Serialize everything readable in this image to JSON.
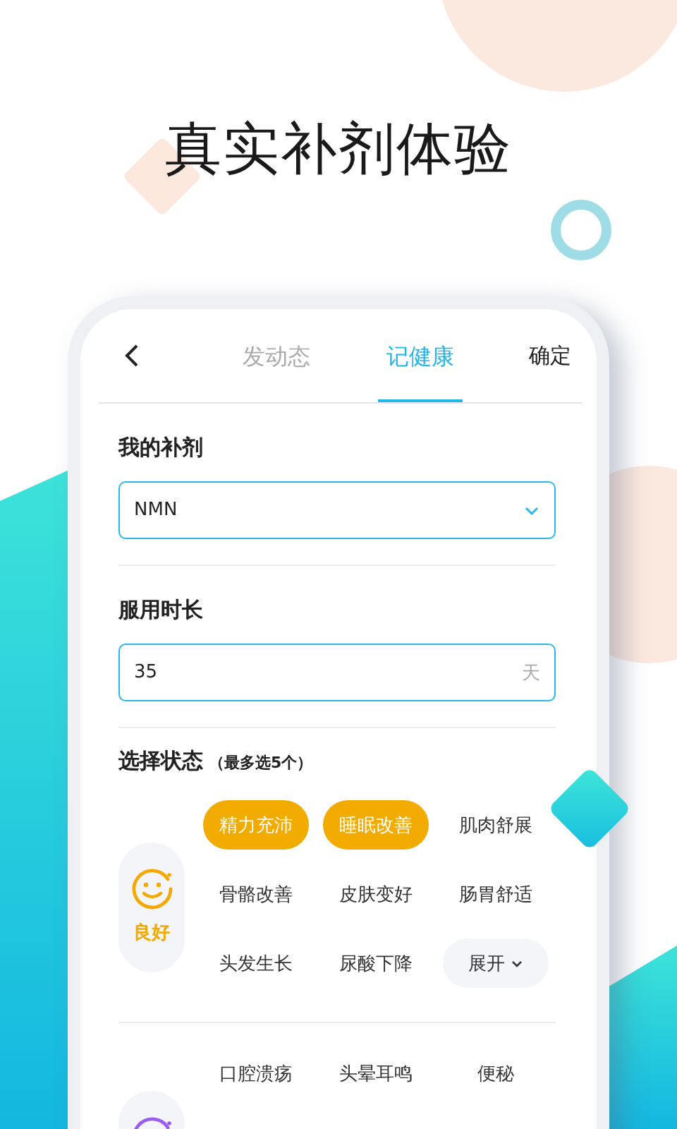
{
  "headline": "真实补剂体验",
  "header": {
    "tabs": [
      {
        "label": "发动态",
        "selected": false
      },
      {
        "label": "记健康",
        "selected": true
      }
    ],
    "confirm": "确定"
  },
  "supplement": {
    "label": "我的补剂",
    "value": "NMN"
  },
  "duration": {
    "label": "服用时长",
    "value": "35",
    "unit": "天"
  },
  "status": {
    "title": "选择状态",
    "hint": "（最多选5个）",
    "groups": [
      {
        "kind": "good",
        "label": "良好",
        "color": "#f5a800",
        "expand": "展开",
        "items": [
          {
            "label": "精力充沛",
            "selected": true
          },
          {
            "label": "睡眠改善",
            "selected": true
          },
          {
            "label": "肌肉舒展",
            "selected": false
          },
          {
            "label": "骨骼改善",
            "selected": false
          },
          {
            "label": "皮肤变好",
            "selected": false
          },
          {
            "label": "肠胃舒适",
            "selected": false
          },
          {
            "label": "头发生长",
            "selected": false
          },
          {
            "label": "尿酸下降",
            "selected": false
          }
        ]
      },
      {
        "kind": "bad",
        "color": "#9b5cf0",
        "items": [
          {
            "label": "口腔溃疡",
            "selected": false
          },
          {
            "label": "头晕耳鸣",
            "selected": false
          },
          {
            "label": "便秘",
            "selected": false
          }
        ]
      }
    ]
  }
}
